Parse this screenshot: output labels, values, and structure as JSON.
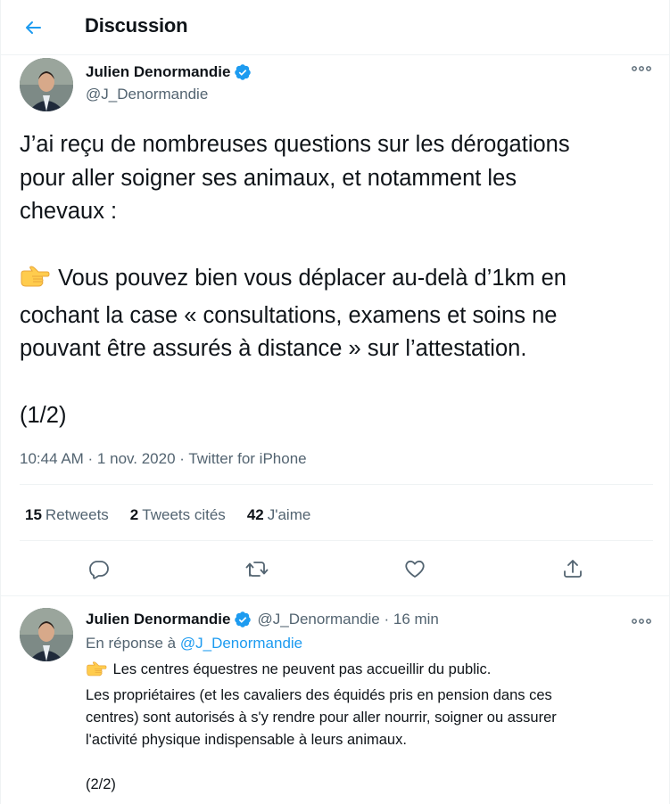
{
  "header": {
    "title": "Discussion",
    "back_icon": "arrow-left-icon"
  },
  "colors": {
    "accent": "#1d9bf0",
    "text": "#0f1419",
    "muted": "#536471",
    "border": "#eff3f4"
  },
  "main_tweet": {
    "author_name": "Julien Denormandie",
    "handle": "@J_Denormandie",
    "verified_icon": "verified-badge-icon",
    "more_icon": "more-options-icon",
    "paragraph1": "J’ai reçu de nombreuses questions sur les dérogations\npour aller soigner ses animaux, et notamment les\nchevaux :",
    "emoji": "backhand-index-pointing-right-icon",
    "paragraph2": " Vous pouvez bien vous déplacer au-delà d’1km en\ncochant la case « consultations, examens et soins ne\npouvant être assurés à distance » sur l’attestation.",
    "paragraph3": "(1/2)",
    "timestamp": "10:44 AM · 1 nov. 2020 · Twitter for iPhone",
    "stats": {
      "retweets_count": "15",
      "retweets_label": "Retweets",
      "quotes_count": "2",
      "quotes_label": "Tweets cités",
      "likes_count": "42",
      "likes_label": "J'aime"
    },
    "actions": {
      "reply_icon": "reply-icon",
      "retweet_icon": "retweet-icon",
      "like_icon": "heart-icon",
      "share_icon": "share-icon"
    }
  },
  "reply_tweet": {
    "author_name": "Julien Denormandie",
    "handle_time": "@J_Denormandie · 16 min",
    "in_reply_prefix": "En réponse à ",
    "in_reply_handle": "@J_Denormandie",
    "line1": " Les centres équestres ne peuvent pas accueillir du public.",
    "body_rest": "Les propriétaires (et les cavaliers des équidés pris en pension dans ces\ncentres) sont autorisés à s'y rendre pour aller nourrir, soigner ou assurer\nl'activité physique indispensable à leurs animaux.",
    "footer": "(2/2)"
  }
}
